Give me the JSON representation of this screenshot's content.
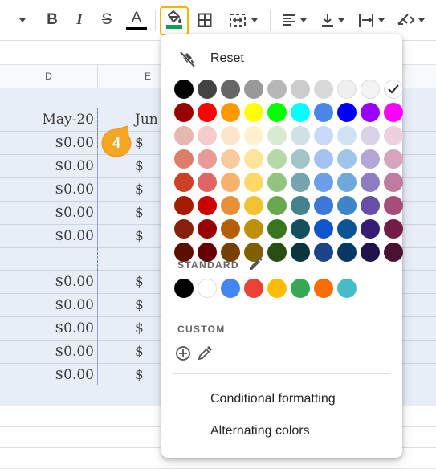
{
  "toolbar": {
    "bold_label": "B",
    "italic_label": "I",
    "strike_label": "S",
    "text_color_label": "A",
    "text_color": "#000000",
    "fill_color_indicator": "#0f9d58",
    "highlight_border": "#f4b400"
  },
  "sheet": {
    "columns": [
      {
        "label": "D"
      },
      {
        "label": "E"
      }
    ],
    "band_color": "#e8eef8",
    "rows_group1": [
      {
        "d": "May-20",
        "e": "Jun"
      },
      {
        "d": "$0.00",
        "e": "$"
      },
      {
        "d": "$0.00",
        "e": "$"
      },
      {
        "d": "$0.00",
        "e": "$"
      },
      {
        "d": "$0.00",
        "e": "$"
      },
      {
        "d": "$0.00",
        "e": "$"
      }
    ],
    "rows_group2": [
      {
        "d": "$0.00",
        "e": "$"
      },
      {
        "d": "$0.00",
        "e": "$"
      },
      {
        "d": "$0.00",
        "e": "$"
      },
      {
        "d": "$0.00",
        "e": "$"
      },
      {
        "d": "$0.00",
        "e": "$"
      }
    ]
  },
  "step_badge": {
    "number": "4",
    "color": "#f5a623"
  },
  "popup": {
    "reset_label": "Reset",
    "standard_label": "STANDARD",
    "custom_label": "CUSTOM",
    "conditional_formatting_label": "Conditional formatting",
    "alternating_colors_label": "Alternating colors",
    "selected_color": "#ffffff",
    "palette": [
      [
        "#000000",
        "#434343",
        "#666666",
        "#999999",
        "#b7b7b7",
        "#cccccc",
        "#d9d9d9",
        "#efefef",
        "#f3f3f3",
        "#ffffff"
      ],
      [
        "#980000",
        "#ff0000",
        "#ff9900",
        "#ffff00",
        "#00ff00",
        "#00ffff",
        "#4a86e8",
        "#0000ff",
        "#9900ff",
        "#ff00ff"
      ],
      [
        "#e6b8af",
        "#f4cccc",
        "#fce5cd",
        "#fff2cc",
        "#d9ead3",
        "#d0e0e3",
        "#c9daf8",
        "#cfe2f3",
        "#d9d2e9",
        "#ead1dc"
      ],
      [
        "#dd7e6b",
        "#ea9999",
        "#f9cb9c",
        "#ffe599",
        "#b6d7a8",
        "#a2c4c9",
        "#a4c2f4",
        "#9fc5e8",
        "#b4a7d6",
        "#d5a6bd"
      ],
      [
        "#cc4125",
        "#e06666",
        "#f6b26b",
        "#ffd966",
        "#93c47d",
        "#76a5af",
        "#6d9eeb",
        "#6fa8dc",
        "#8e7cc3",
        "#c27ba0"
      ],
      [
        "#a61c00",
        "#cc0000",
        "#e69138",
        "#f1c232",
        "#6aa84f",
        "#45818e",
        "#3c78d8",
        "#3d85c6",
        "#674ea7",
        "#a64d79"
      ],
      [
        "#85200c",
        "#990000",
        "#b45f06",
        "#bf9000",
        "#38761d",
        "#134f5c",
        "#1155cc",
        "#0b5394",
        "#351c75",
        "#741b47"
      ],
      [
        "#5b0f00",
        "#660000",
        "#783f04",
        "#7f6000",
        "#274e13",
        "#0c343d",
        "#1c4587",
        "#073763",
        "#20124d",
        "#4c1130"
      ]
    ],
    "standard_colors": [
      "#000000",
      "#ffffff",
      "#4285f4",
      "#ea4335",
      "#fbbc04",
      "#34a853",
      "#ff6d01",
      "#46bdc6"
    ]
  }
}
